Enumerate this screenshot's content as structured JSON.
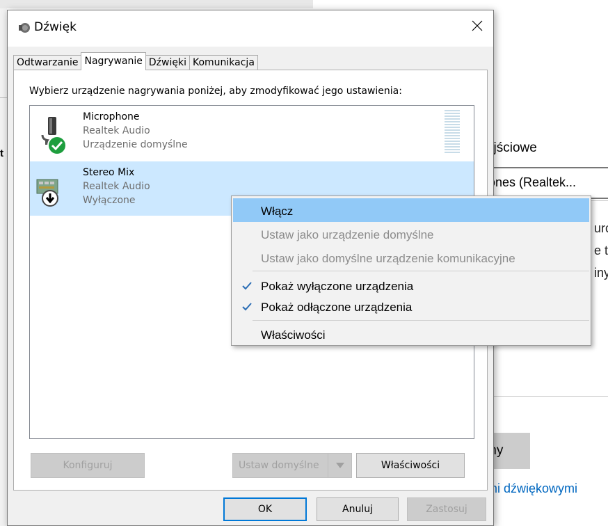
{
  "background": {
    "heading": "yjściowe",
    "dropdown_value": "ones (Realtek...",
    "box_fragments": [
      "urc",
      "e t",
      "iny"
    ],
    "button_label": "my",
    "link_text": "mi dźwiękowymi",
    "left_fragment": "t"
  },
  "dialog": {
    "title": "Dźwięk",
    "tabs": [
      {
        "label": "Odtwarzanie"
      },
      {
        "label": "Nagrywanie"
      },
      {
        "label": "Dźwięki"
      },
      {
        "label": "Komunikacja"
      }
    ],
    "active_tab": "Nagrywanie",
    "instruction": "Wybierz urządzenie nagrywania poniżej, aby zmodyfikować jego ustawienia:",
    "devices": [
      {
        "name": "Microphone",
        "driver": "Realtek Audio",
        "status": "Urządzenie domyślne",
        "state_icon": "green-check-icon"
      },
      {
        "name": "Stereo Mix",
        "driver": "Realtek Audio",
        "status": "Wyłączone",
        "state_icon": "disabled-arrow-icon"
      }
    ],
    "buttons": {
      "configure": "Konfiguruj",
      "set_default": "Ustaw domyślne",
      "properties": "Właściwości",
      "ok": "OK",
      "cancel": "Anuluj",
      "apply": "Zastosuj"
    }
  },
  "context_menu": {
    "items": [
      {
        "label": "Włącz",
        "state": "highlighted"
      },
      {
        "label": "Ustaw jako urządzenie domyślne",
        "state": "disabled"
      },
      {
        "label": "Ustaw jako domyślne urządzenie komunikacyjne",
        "state": "disabled"
      },
      {
        "label": "Pokaż wyłączone urządzenia",
        "state": "checked"
      },
      {
        "label": "Pokaż odłączone urządzenia",
        "state": "checked"
      },
      {
        "label": "Właściwości",
        "state": "normal"
      }
    ]
  },
  "colors": {
    "selection": "#cce8ff",
    "menu_highlight": "#91c9f7",
    "accent": "#0078d7",
    "check_green": "#1e9e3e"
  }
}
